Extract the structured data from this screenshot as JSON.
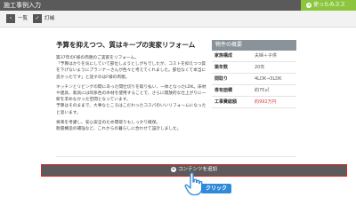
{
  "topbar": {
    "title": "施工事例入力",
    "use_button": "使ったみスス",
    "use_icon": "circle-arrow-icon"
  },
  "toolbar": {
    "back_label": "一覧",
    "save_label": "訂補",
    "back_icon": "list-icon",
    "save_icon": "save-icon"
  },
  "article": {
    "heading": "予算を抑えつつ、質はキープの実家リフォーム",
    "paragraphs": [
      "築37年のF様の両親のご実家をリフォーム。\n「予算はかりを気にしていて部位しようとしがちでしたが、コストを抑えつつ質を下げないようにプランナーさんが色々と考えてくれました。部位なくて本当に良かったです」と話すのはF様の両親。",
      "キッチンとリビングの間にあった間仕切りを取り払い、一体となったLDK。床材や建具、家具には同系色の木材を使用することで、さらに開放的な仕上がりに一新を求めなかった空間となっています。\n予算はそのままで、大事なところはこだわったコスパのいいリフォームになったと思います。",
      "将来を考慮し、安心安全のため間取りもしっかり確保。\n耐震構造の補強など、これからの暮らしに合わせて設計しました。"
    ]
  },
  "summary": {
    "title": "物件の概要",
    "rows": [
      {
        "key": "家族構成",
        "value": "夫婦＋子供",
        "highlight": false
      },
      {
        "key": "築年数",
        "value": "20年",
        "highlight": false
      },
      {
        "key": "間取り",
        "value": "4LDK→3LDK",
        "highlight": false
      },
      {
        "key": "専有面積",
        "value": "約75㎡",
        "highlight": false
      },
      {
        "key": "工事費総額",
        "value": "約992万円",
        "highlight": true
      }
    ]
  },
  "add_content": {
    "label": "コンテンツを追加",
    "icon": "plus-circle-icon"
  },
  "callout": {
    "label": "クリック",
    "icon": "pointer-hand-icon"
  },
  "colors": {
    "topbar": "#5a5a5a",
    "accent_green": "#8cc63f",
    "highlight_red": "#e02020",
    "callout_blue": "#2f8ad8"
  }
}
